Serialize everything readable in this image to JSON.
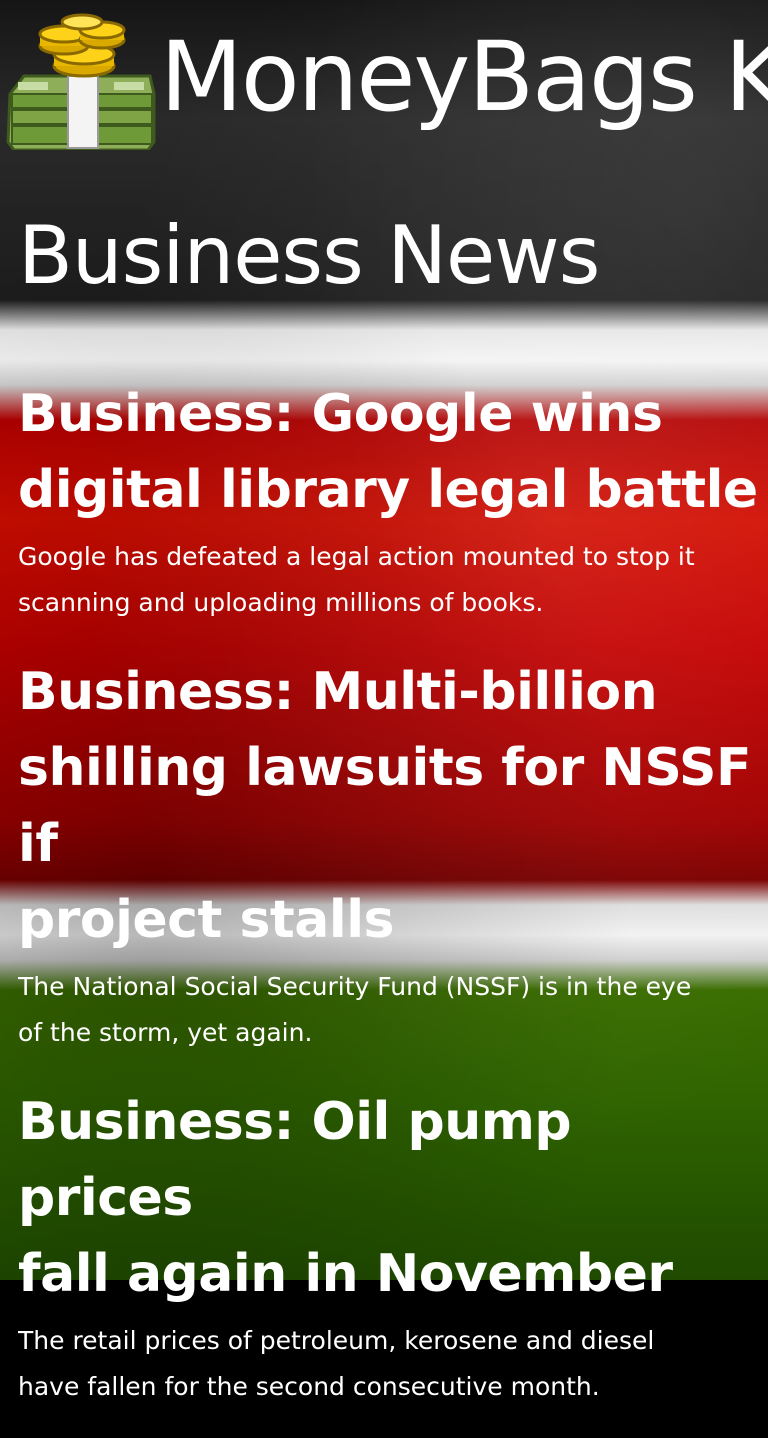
{
  "app": {
    "title": "MoneyBags K",
    "logo_icon": "money-bags-icon"
  },
  "page": {
    "title": "Business News"
  },
  "news": [
    {
      "headline": "Business: Google wins\ndigital library legal battle",
      "summary": "Google has defeated a legal action mounted to stop it\nscanning and uploading millions of books."
    },
    {
      "headline": "Business: Multi-billion\nshilling lawsuits for NSSF if\nproject stalls",
      "summary": "The National Social Security Fund (NSSF) is in the eye\nof the storm, yet again."
    },
    {
      "headline": "Business: Oil pump prices\nfall again in November",
      "summary": "The retail prices of petroleum, kerosene and diesel\nhave fallen for the second consecutive month."
    }
  ],
  "colors": {
    "flag_black": "#1c1c1c",
    "flag_white": "#f2f2f2",
    "flag_red": "#c30000",
    "flag_green": "#2f6400",
    "text": "#ffffff"
  }
}
